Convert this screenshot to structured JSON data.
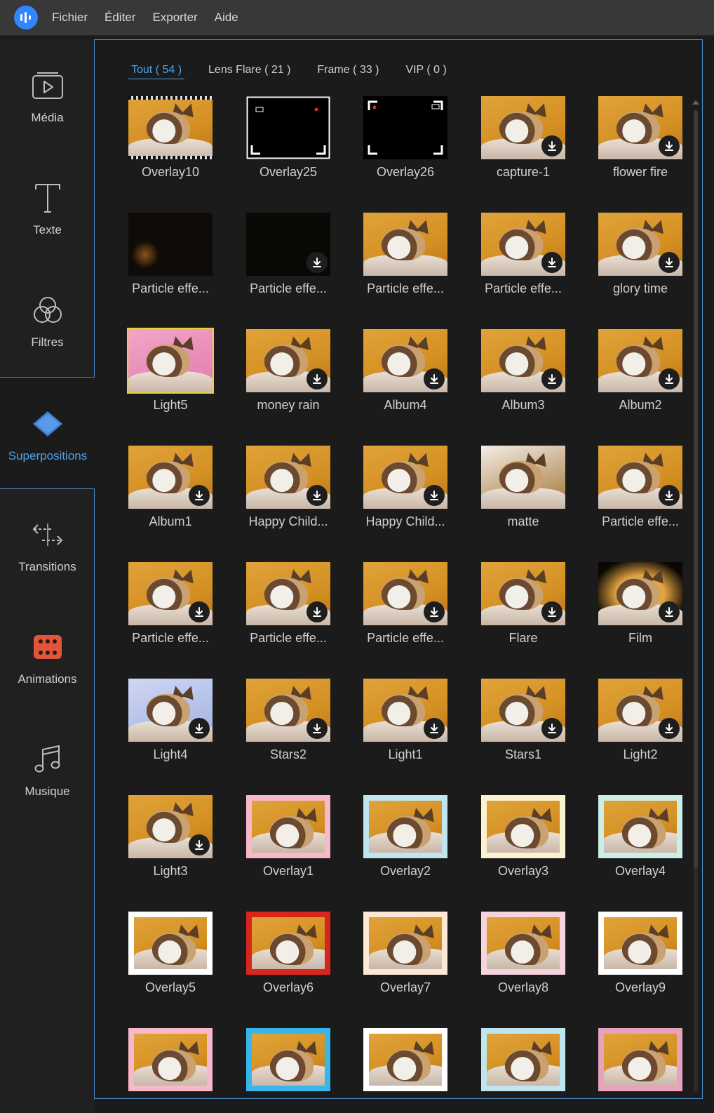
{
  "menu": [
    "Fichier",
    "Éditer",
    "Exporter",
    "Aide"
  ],
  "sidebar": [
    {
      "label": "Média",
      "icon": "media-icon"
    },
    {
      "label": "Texte",
      "icon": "text-icon"
    },
    {
      "label": "Filtres",
      "icon": "filters-icon"
    },
    {
      "label": "Superpositions",
      "icon": "overlays-icon",
      "active": true
    },
    {
      "label": "Transitions",
      "icon": "transitions-icon"
    },
    {
      "label": "Animations",
      "icon": "animations-icon"
    },
    {
      "label": "Musique",
      "icon": "music-icon"
    }
  ],
  "tabs": [
    {
      "label": "Tout ( 54 )",
      "active": true
    },
    {
      "label": "Lens Flare ( 21 )"
    },
    {
      "label": "Frame ( 33 )"
    },
    {
      "label": "VIP ( 0 )"
    }
  ],
  "items": [
    {
      "name": "Overlay10",
      "style": "film"
    },
    {
      "name": "Overlay25",
      "style": "rec-white"
    },
    {
      "name": "Overlay26",
      "style": "rec-black"
    },
    {
      "name": "capture-1",
      "style": "capture",
      "download": true
    },
    {
      "name": "flower fire",
      "style": "flower",
      "download": true
    },
    {
      "name": "Particle effe...",
      "style": "dark-orb"
    },
    {
      "name": "Particle effe...",
      "style": "dark-stars",
      "download": true
    },
    {
      "name": "Particle effe...",
      "style": "cat"
    },
    {
      "name": "Particle effe...",
      "style": "cat-swirl",
      "download": true
    },
    {
      "name": "glory time",
      "style": "glory",
      "download": true
    },
    {
      "name": "Light5",
      "style": "pink",
      "selected": true
    },
    {
      "name": "money rain",
      "style": "cat-gold",
      "download": true
    },
    {
      "name": "Album4",
      "style": "album",
      "download": true
    },
    {
      "name": "Album3",
      "style": "album",
      "download": true
    },
    {
      "name": "Album2",
      "style": "album",
      "download": true
    },
    {
      "name": "Album1",
      "style": "album",
      "download": true
    },
    {
      "name": "Happy Child...",
      "style": "cloud",
      "download": true
    },
    {
      "name": "Happy Child...",
      "style": "blueframe",
      "download": true
    },
    {
      "name": "matte",
      "style": "matte"
    },
    {
      "name": "Particle effe...",
      "style": "cat-swirl",
      "download": true
    },
    {
      "name": "Particle effe...",
      "style": "flare-blue",
      "download": true
    },
    {
      "name": "Particle effe...",
      "style": "flare-ring",
      "download": true
    },
    {
      "name": "Particle effe...",
      "style": "cat-gold",
      "download": true
    },
    {
      "name": "Flare",
      "style": "cat",
      "download": true
    },
    {
      "name": "Film",
      "style": "film-dark",
      "download": true
    },
    {
      "name": "Light4",
      "style": "light-blue",
      "download": true
    },
    {
      "name": "Stars2",
      "style": "cat-gold",
      "download": true
    },
    {
      "name": "Light1",
      "style": "cat",
      "download": true
    },
    {
      "name": "Stars1",
      "style": "cat",
      "download": true
    },
    {
      "name": "Light2",
      "style": "cat",
      "download": true
    },
    {
      "name": "Light3",
      "style": "cat",
      "download": true
    },
    {
      "name": "Overlay1",
      "style": "frame-pink"
    },
    {
      "name": "Overlay2",
      "style": "frame-cyan"
    },
    {
      "name": "Overlay3",
      "style": "frame-cream"
    },
    {
      "name": "Overlay4",
      "style": "frame-mint"
    },
    {
      "name": "Overlay5",
      "style": "frame-white"
    },
    {
      "name": "Overlay6",
      "style": "frame-red"
    },
    {
      "name": "Overlay7",
      "style": "frame-peach"
    },
    {
      "name": "Overlay8",
      "style": "frame-heart"
    },
    {
      "name": "Overlay9",
      "style": "frame-plain"
    },
    {
      "name": "",
      "style": "frame-pink"
    },
    {
      "name": "",
      "style": "frame-blue"
    },
    {
      "name": "",
      "style": "frame-plain"
    },
    {
      "name": "",
      "style": "frame-cyan"
    },
    {
      "name": "",
      "style": "frame-magenta"
    }
  ]
}
